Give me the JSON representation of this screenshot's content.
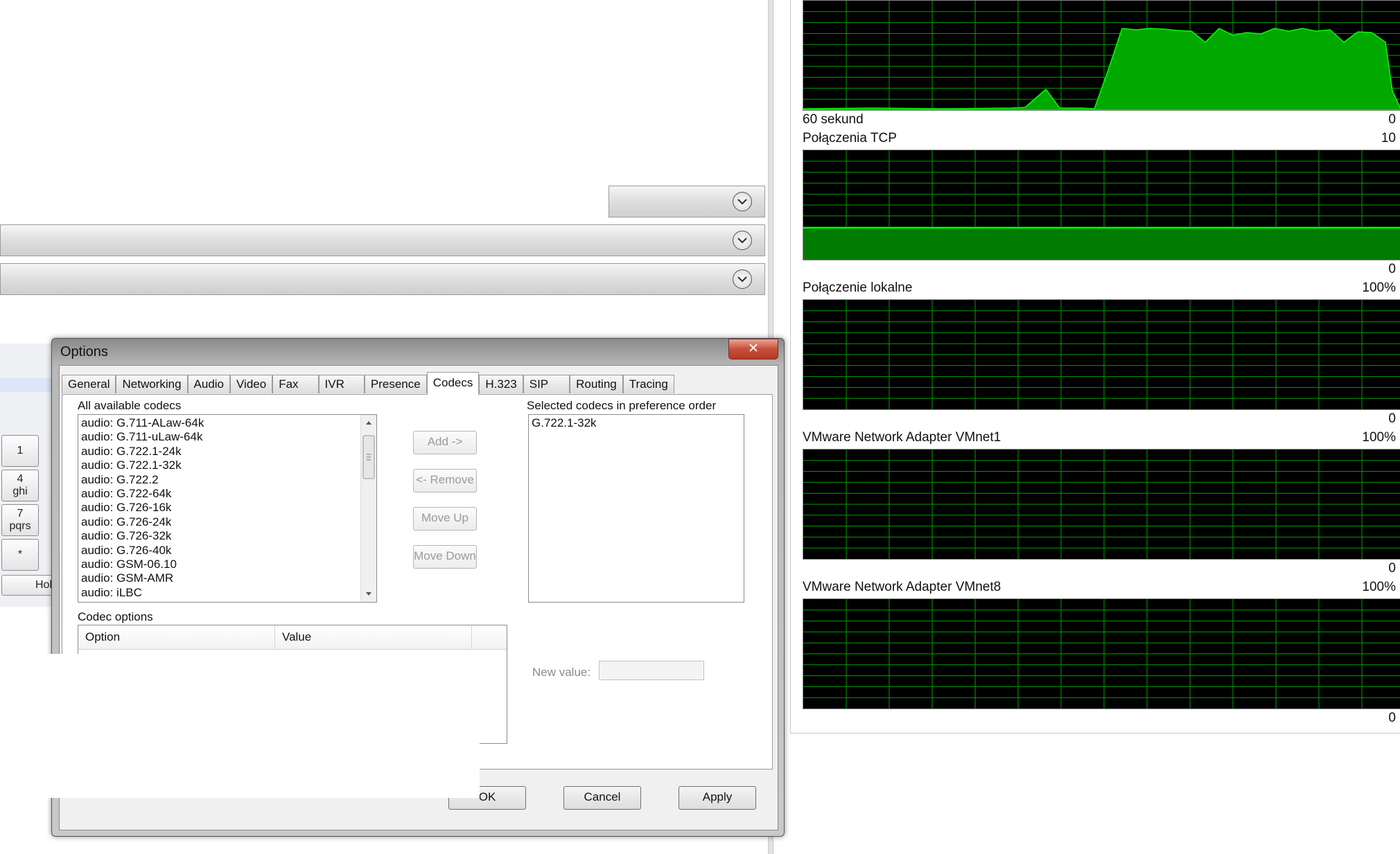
{
  "network": {
    "time_label": "60 sekund",
    "graphs": [
      {
        "name": "",
        "max": "",
        "min": "0"
      },
      {
        "name": "Połączenia TCP",
        "max": "10",
        "min": "0"
      },
      {
        "name": "Połączenie lokalne",
        "max": "100%",
        "min": "0"
      },
      {
        "name": "VMware Network Adapter VMnet1",
        "max": "100%",
        "min": "0"
      },
      {
        "name": "VMware Network Adapter VMnet8",
        "max": "100%",
        "min": "0"
      }
    ],
    "colors": {
      "background": "#000000",
      "grid": "#00a000",
      "trace": "#00e000",
      "fill": "#00b000"
    }
  },
  "dialer": {
    "keys": [
      {
        "main": "1",
        "sub": ""
      },
      {
        "main": "4",
        "sub": "ghi"
      },
      {
        "main": "7",
        "sub": "pqrs"
      },
      {
        "main": "*",
        "sub": ""
      }
    ],
    "hold_label": "Hol"
  },
  "dialog": {
    "title": "Options",
    "close_glyph": "✕",
    "tabs": [
      "General",
      "Networking",
      "Audio",
      "Video",
      "Fax",
      "IVR",
      "Presence",
      "Codecs",
      "H.323",
      "SIP",
      "Routing",
      "Tracing"
    ],
    "active_tab": "Codecs",
    "all_codecs_label": "All available codecs",
    "all_codecs": [
      "audio: G.711-ALaw-64k",
      "audio: G.711-uLaw-64k",
      "audio: G.722.1-24k",
      "audio: G.722.1-32k",
      "audio: G.722.2",
      "audio: G.722-64k",
      "audio: G.726-16k",
      "audio: G.726-24k",
      "audio: G.726-32k",
      "audio: G.726-40k",
      "audio: GSM-06.10",
      "audio: GSM-AMR",
      "audio: iLBC"
    ],
    "selected_codecs_label": "Selected codecs in preference order",
    "selected_codecs": [
      "G.722.1-32k"
    ],
    "side_buttons": {
      "add": "Add ->",
      "remove": "<- Remove",
      "move_up": "Move Up",
      "move_down": "Move Down"
    },
    "codec_options_label": "Codec options",
    "table_columns": [
      "Option",
      "Value"
    ],
    "new_value_label": "New value:",
    "new_value": "",
    "buttons": {
      "ok": "OK",
      "cancel": "Cancel",
      "apply": "Apply"
    }
  }
}
